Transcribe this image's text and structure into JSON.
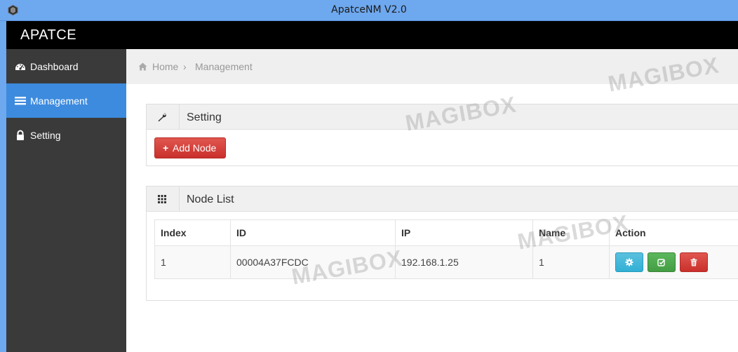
{
  "window": {
    "title": "ApatceNM V2.0"
  },
  "navbar": {
    "brand": "APATCE"
  },
  "sidebar": {
    "items": [
      {
        "label": "Dashboard",
        "icon": "dashboard-icon",
        "active": false
      },
      {
        "label": "Management",
        "icon": "list-icon",
        "active": true
      },
      {
        "label": "Setting",
        "icon": "lock-icon",
        "active": false
      }
    ]
  },
  "breadcrumb": {
    "home": "Home",
    "separator": "›",
    "current": "Management"
  },
  "setting_panel": {
    "title": "Setting",
    "icon": "wrench-icon",
    "add_button": {
      "plus": "+",
      "label": "Add Node"
    }
  },
  "node_panel": {
    "title": "Node List",
    "icon": "grid-icon",
    "columns": [
      "Index",
      "ID",
      "IP",
      "Name",
      "Action"
    ],
    "rows": [
      {
        "index": "1",
        "id": "00004A37FCDC",
        "ip": "192.168.1.25",
        "name": "1"
      }
    ],
    "actions": [
      "gear-icon",
      "edit-icon",
      "trash-icon"
    ]
  },
  "watermark": "MAGIBOX",
  "colors": {
    "accent": "#3d8bde",
    "sidebar": "#3a3a3a",
    "navbar": "#000000",
    "titlebar": "#6ea8ee",
    "danger": "#d9534f",
    "success": "#5cb85c",
    "info": "#5bc0de"
  }
}
